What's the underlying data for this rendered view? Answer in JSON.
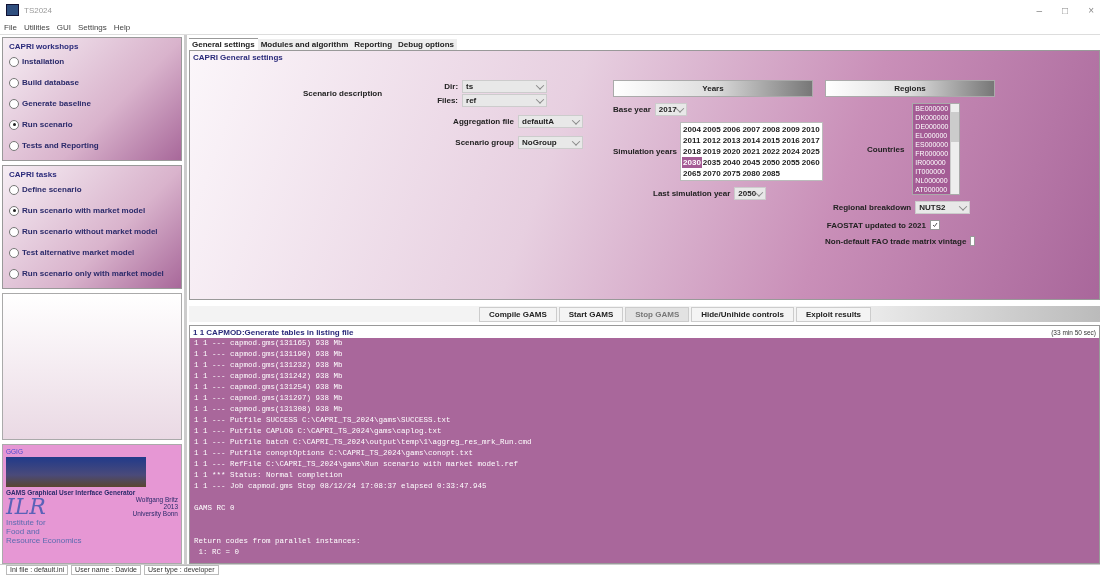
{
  "window": {
    "title": "TS2024",
    "controls": [
      "–",
      "□",
      "×"
    ]
  },
  "menu": [
    "File",
    "Utilities",
    "GUI",
    "Settings",
    "Help"
  ],
  "workshops": {
    "title": "CAPRI workshops",
    "items": [
      {
        "label": "Installation",
        "selected": false
      },
      {
        "label": "Build database",
        "selected": false
      },
      {
        "label": "Generate baseline",
        "selected": false
      },
      {
        "label": "Run scenario",
        "selected": true
      },
      {
        "label": "Tests and Reporting",
        "selected": false
      }
    ]
  },
  "tasks": {
    "title": "CAPRI tasks",
    "items": [
      {
        "label": "Define scenario",
        "selected": false
      },
      {
        "label": "Run scenario with market model",
        "selected": true
      },
      {
        "label": "Run scenario without market model",
        "selected": false
      },
      {
        "label": "Test alternative market model",
        "selected": false
      },
      {
        "label": "Run scenario only with market model",
        "selected": false
      }
    ]
  },
  "logo": {
    "heading": "GGIG",
    "caption": "GAMS Graphical User Interface Generator",
    "author": "Wolfgang Britz",
    "year": "2013",
    "university": "University Bonn",
    "mark": "ILR",
    "institute": [
      "Institute for",
      "Food and",
      "Resource Economics"
    ]
  },
  "tabs": [
    {
      "label": "General settings",
      "selected": true
    },
    {
      "label": "Modules and algorithm",
      "selected": false
    },
    {
      "label": "Reporting",
      "selected": false
    },
    {
      "label": "Debug options",
      "selected": false
    }
  ],
  "settings": {
    "title": "CAPRI General settings",
    "scenario_label": "Scenario description",
    "dir": {
      "label": "Dir:",
      "value": "ts"
    },
    "files": {
      "label": "Files:",
      "value": "ref"
    },
    "aggregation": {
      "label": "Aggregation file",
      "value": "defaultA"
    },
    "group": {
      "label": "Scenario group",
      "value": "NoGroup"
    },
    "years": {
      "header": "Years",
      "base_label": "Base year",
      "base_value": "2017",
      "sim_label": "Simulation years",
      "sim_years": [
        {
          "label": "2004",
          "selected": false
        },
        {
          "label": "2005",
          "selected": false
        },
        {
          "label": "2006",
          "selected": false
        },
        {
          "label": "2007",
          "selected": false
        },
        {
          "label": "2008",
          "selected": false
        },
        {
          "label": "2009",
          "selected": false
        },
        {
          "label": "2010",
          "selected": false
        },
        {
          "label": "2011",
          "selected": false
        },
        {
          "label": "2012",
          "selected": false
        },
        {
          "label": "2013",
          "selected": false
        },
        {
          "label": "2014",
          "selected": false
        },
        {
          "label": "2015",
          "selected": false
        },
        {
          "label": "2016",
          "selected": false
        },
        {
          "label": "2017",
          "selected": false
        },
        {
          "label": "2018",
          "selected": false
        },
        {
          "label": "2019",
          "selected": false
        },
        {
          "label": "2020",
          "selected": false
        },
        {
          "label": "2021",
          "selected": false
        },
        {
          "label": "2022",
          "selected": false
        },
        {
          "label": "2024",
          "selected": false
        },
        {
          "label": "2025",
          "selected": false
        },
        {
          "label": "2030",
          "selected": true
        },
        {
          "label": "2035",
          "selected": false
        },
        {
          "label": "2040",
          "selected": false
        },
        {
          "label": "2045",
          "selected": false
        },
        {
          "label": "2050",
          "selected": false
        },
        {
          "label": "2055",
          "selected": false
        },
        {
          "label": "2060",
          "selected": false
        },
        {
          "label": "2065",
          "selected": false
        },
        {
          "label": "2070",
          "selected": false
        },
        {
          "label": "2075",
          "selected": false
        },
        {
          "label": "2080",
          "selected": false
        },
        {
          "label": "2085",
          "selected": false
        }
      ],
      "last_label": "Last simulation year",
      "last_value": "2050"
    },
    "regions": {
      "header": "Regions",
      "countries_label": "Countries",
      "countries": [
        {
          "label": "BE000000",
          "selected": true
        },
        {
          "label": "DK000000",
          "selected": true
        },
        {
          "label": "DE000000",
          "selected": true
        },
        {
          "label": "EL000000",
          "selected": true
        },
        {
          "label": "ES000000",
          "selected": true
        },
        {
          "label": "FR000000",
          "selected": true
        },
        {
          "label": "IR000000",
          "selected": true
        },
        {
          "label": "IT000000",
          "selected": true
        },
        {
          "label": "NL000000",
          "selected": true
        },
        {
          "label": "AT000000",
          "selected": true
        }
      ],
      "breakdown_label": "Regional breakdown",
      "breakdown_value": "NUTS2",
      "checks": [
        {
          "label": "FAOSTAT updated to 2021",
          "checked": true
        },
        {
          "label": "Non-default FAO trade matrix vintage",
          "checked": false
        }
      ]
    }
  },
  "buttons": [
    {
      "label": "Compile GAMS",
      "disabled": false
    },
    {
      "label": "Start GAMS",
      "disabled": false
    },
    {
      "label": "Stop GAMS",
      "disabled": true
    },
    {
      "label": "Hide/Unihide controls",
      "disabled": false
    },
    {
      "label": "Exploit results",
      "disabled": false
    }
  ],
  "log": {
    "title": "1 1  CAPMOD:Generate tables in listing file",
    "elapsed": "(33 min 50 sec)",
    "lines": [
      "1 1 --- capmod.gms(131165) 938 Mb",
      "1 1 --- capmod.gms(131190) 938 Mb",
      "1 1 --- capmod.gms(131232) 938 Mb",
      "1 1 --- capmod.gms(131242) 938 Mb",
      "1 1 --- capmod.gms(131254) 938 Mb",
      "1 1 --- capmod.gms(131297) 938 Mb",
      "1 1 --- capmod.gms(131308) 938 Mb",
      "1 1 --- Putfile SUCCESS C:\\CAPRI_TS_2024\\gams\\SUCCESS.txt",
      "1 1 --- Putfile CAPLOG C:\\CAPRI_TS_2024\\gams\\caplog.txt",
      "1 1 --- Putfile batch C:\\CAPRI_TS_2024\\output\\temp\\1\\aggreg_res_mrk_Run.cmd",
      "1 1 --- Putfile conoptOptions C:\\CAPRI_TS_2024\\gams\\conopt.txt",
      "1 1 --- RefFile C:\\CAPRI_TS_2024\\gams\\Run scenario with market model.ref",
      "1 1 *** Status: Normal completion",
      "1 1 --- Job capmod.gms Stop 08/12/24 17:08:37 elapsed 0:33:47.945",
      {
        "kind": "blank"
      },
      "GAMS RC 0",
      {
        "kind": "blank"
      },
      {
        "kind": "blank"
      },
      "Return codes from parallel instances:",
      " 1: RC = 0"
    ]
  },
  "status_bar": [
    "Ini file : default.ini",
    "User name : Davide",
    "User type : developer"
  ]
}
